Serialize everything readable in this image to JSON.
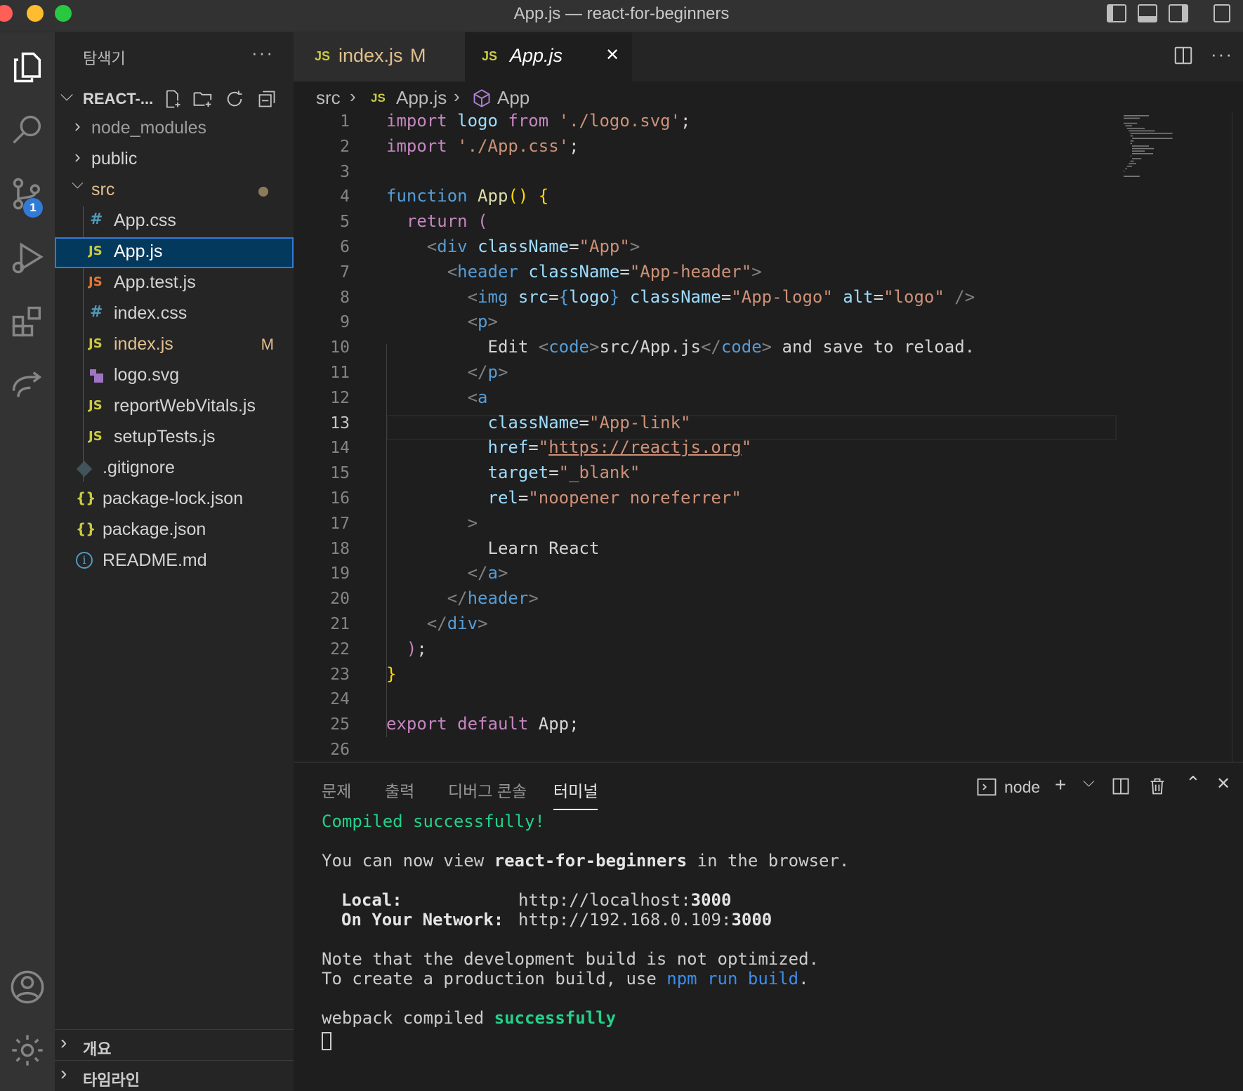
{
  "window": {
    "title": "App.js — react-for-beginners",
    "traffic_colors": [
      "#ff5f57",
      "#febc2e",
      "#28c840"
    ]
  },
  "activity_bar": {
    "items": [
      "explorer-icon",
      "search-icon",
      "source-control-icon",
      "run-debug-icon",
      "extensions-icon",
      "remote-explorer-icon"
    ],
    "source_control_badge": "1",
    "bottom": [
      "account-icon",
      "settings-gear-icon"
    ]
  },
  "sidebar": {
    "title": "탐색기",
    "more": "···",
    "project": "REACT-...",
    "tree": [
      {
        "name": "node_modules",
        "type": "folder",
        "open": false
      },
      {
        "name": "public",
        "type": "folder",
        "open": false
      },
      {
        "name": "src",
        "type": "folder",
        "open": true
      },
      {
        "name": "App.css",
        "icon": "#"
      },
      {
        "name": "App.js",
        "icon": "JS",
        "selected": true
      },
      {
        "name": "App.test.js",
        "icon": "JS"
      },
      {
        "name": "index.css",
        "icon": "#"
      },
      {
        "name": "index.js",
        "icon": "JS",
        "badge": "M"
      },
      {
        "name": "logo.svg",
        "icon": "svg-icon"
      },
      {
        "name": "reportWebVitals.js",
        "icon": "JS"
      },
      {
        "name": "setupTests.js",
        "icon": "JS"
      },
      {
        "name": ".gitignore",
        "icon": "git-icon"
      },
      {
        "name": "package-lock.json",
        "icon": "{}"
      },
      {
        "name": "package.json",
        "icon": "{}"
      },
      {
        "name": "README.md",
        "icon": "info-icon"
      }
    ],
    "sections": [
      "개요",
      "타임라인"
    ]
  },
  "tabs": [
    {
      "icon": "JS",
      "label": "index.js",
      "badge": "M"
    },
    {
      "icon": "JS",
      "label": "App.js",
      "close": "✕"
    }
  ],
  "breadcrumb": {
    "folder": "src",
    "file": "App.js",
    "symbol": "App"
  },
  "editor": {
    "current_line": 13,
    "lines": [
      "import logo from './logo.svg';",
      "import './App.css';",
      "",
      "function App() {",
      "  return (",
      "    <div className=\"App\">",
      "      <header className=\"App-header\">",
      "        <img src={logo} className=\"App-logo\" alt=\"logo\" />",
      "        <p>",
      "          Edit <code>src/App.js</code> and save to reload.",
      "        </p>",
      "        <a",
      "          className=\"App-link\"",
      "          href=\"https://reactjs.org\"",
      "          target=\"_blank\"",
      "          rel=\"noopener noreferrer\"",
      "        >",
      "          Learn React",
      "        </a>",
      "      </header>",
      "    </div>",
      "  );",
      "}",
      "",
      "export default App;",
      ""
    ]
  },
  "panel": {
    "tabs": [
      "문제",
      "출력",
      "디버그 콘솔",
      "터미널"
    ],
    "active_tab": "터미널",
    "terminal_name": "node",
    "terminal": {
      "compiled": "Compiled successfully!",
      "view_prefix": "You can now view ",
      "project": "react-for-beginners",
      "view_suffix": " in the browser.",
      "local_label": "Local:",
      "local_url": "http://localhost:",
      "local_port": "3000",
      "network_label": "On Your Network:",
      "network_url": "http://192.168.0.109:",
      "network_port": "3000",
      "note": "Note that the development build is not optimized.",
      "create_prefix": "To create a production build, use ",
      "create_cmd": "npm run build",
      "create_suffix": ".",
      "webpack_prefix": "webpack compiled ",
      "webpack_status": "successfully"
    }
  }
}
